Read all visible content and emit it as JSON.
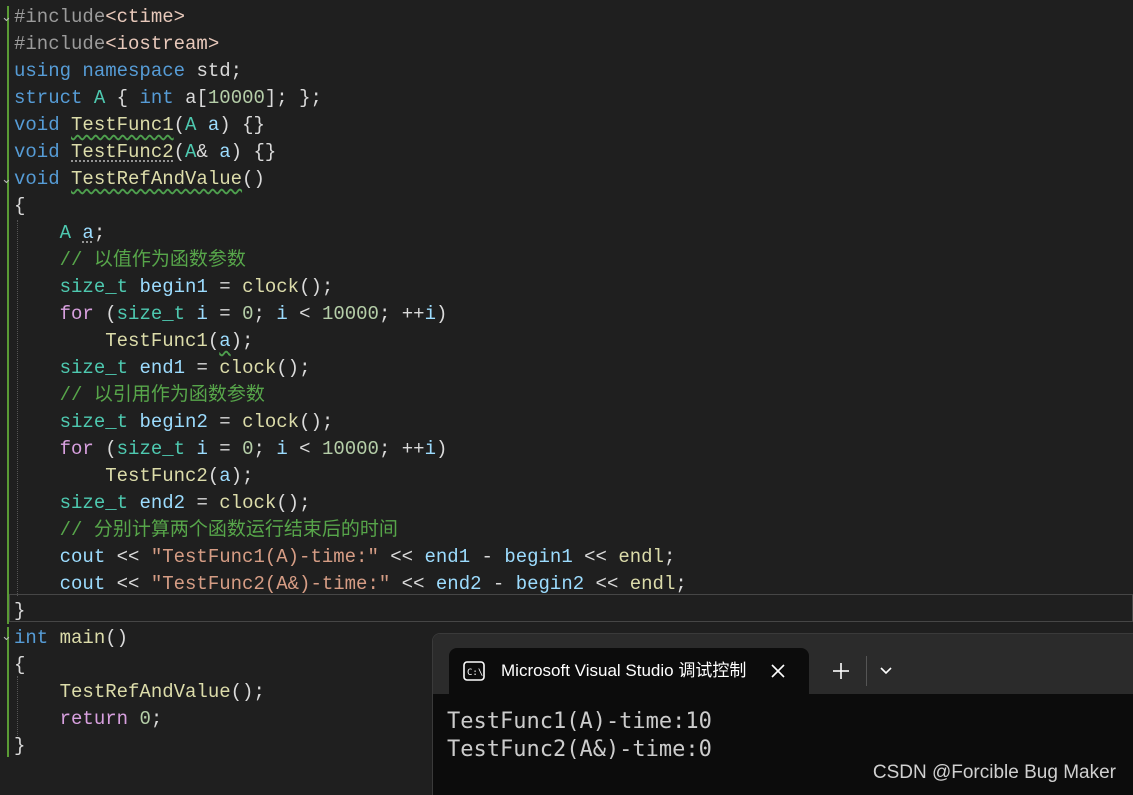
{
  "editor": {
    "lines": [
      [
        [
          "t-pp",
          "#include"
        ],
        [
          "t-inc",
          "<ctime>"
        ]
      ],
      [
        [
          "t-pp",
          "#include"
        ],
        [
          "t-inc",
          "<iostream>"
        ]
      ],
      [
        [
          "t-kw",
          "using"
        ],
        [
          "t-plain",
          " "
        ],
        [
          "t-kw",
          "namespace"
        ],
        [
          "t-plain",
          " std;"
        ]
      ],
      [
        [
          "t-kw",
          "struct"
        ],
        [
          "t-plain",
          " "
        ],
        [
          "t-type",
          "A"
        ],
        [
          "t-plain",
          " { "
        ],
        [
          "t-kw",
          "int"
        ],
        [
          "t-plain",
          " a["
        ],
        [
          "t-num",
          "10000"
        ],
        [
          "t-plain",
          "]; };"
        ]
      ],
      [
        [
          "t-kw",
          "void"
        ],
        [
          "t-plain",
          " "
        ],
        [
          "t-fn squiggle",
          "TestFunc1"
        ],
        [
          "t-plain",
          "("
        ],
        [
          "t-type",
          "A"
        ],
        [
          "t-plain",
          " "
        ],
        [
          "t-var",
          "a"
        ],
        [
          "t-plain",
          ") {}"
        ]
      ],
      [
        [
          "t-kw",
          "void"
        ],
        [
          "t-plain",
          " "
        ],
        [
          "t-fn dotted",
          "TestFunc2"
        ],
        [
          "t-plain",
          "("
        ],
        [
          "t-type",
          "A"
        ],
        [
          "t-plain",
          "& "
        ],
        [
          "t-var",
          "a"
        ],
        [
          "t-plain",
          ") {}"
        ]
      ],
      [
        [
          "t-kw",
          "void"
        ],
        [
          "t-plain",
          " "
        ],
        [
          "t-fn squiggle",
          "TestRefAndValue"
        ],
        [
          "t-plain",
          "()"
        ]
      ],
      [
        [
          "t-plain",
          "{"
        ]
      ],
      [
        [
          "t-plain",
          "    "
        ],
        [
          "t-type",
          "A"
        ],
        [
          "t-plain",
          " "
        ],
        [
          "t-var dotted",
          "a"
        ],
        [
          "t-plain",
          ";"
        ]
      ],
      [
        [
          "t-plain",
          "    "
        ],
        [
          "t-cmt",
          "// 以值作为函数参数"
        ]
      ],
      [
        [
          "t-plain",
          "    "
        ],
        [
          "t-type",
          "size_t"
        ],
        [
          "t-plain",
          " "
        ],
        [
          "t-var",
          "begin1"
        ],
        [
          "t-plain",
          " = "
        ],
        [
          "t-fn",
          "clock"
        ],
        [
          "t-plain",
          "();"
        ]
      ],
      [
        [
          "t-plain",
          "    "
        ],
        [
          "t-ctl",
          "for"
        ],
        [
          "t-plain",
          " ("
        ],
        [
          "t-type",
          "size_t"
        ],
        [
          "t-plain",
          " "
        ],
        [
          "t-var",
          "i"
        ],
        [
          "t-plain",
          " = "
        ],
        [
          "t-num",
          "0"
        ],
        [
          "t-plain",
          "; "
        ],
        [
          "t-var",
          "i"
        ],
        [
          "t-plain",
          " < "
        ],
        [
          "t-num",
          "10000"
        ],
        [
          "t-plain",
          "; ++"
        ],
        [
          "t-var",
          "i"
        ],
        [
          "t-plain",
          ")"
        ]
      ],
      [
        [
          "t-plain",
          "        "
        ],
        [
          "t-fn",
          "TestFunc1"
        ],
        [
          "t-plain",
          "("
        ],
        [
          "t-var squiggle",
          "a"
        ],
        [
          "t-plain",
          ");"
        ]
      ],
      [
        [
          "t-plain",
          "    "
        ],
        [
          "t-type",
          "size_t"
        ],
        [
          "t-plain",
          " "
        ],
        [
          "t-var",
          "end1"
        ],
        [
          "t-plain",
          " = "
        ],
        [
          "t-fn",
          "clock"
        ],
        [
          "t-plain",
          "();"
        ]
      ],
      [
        [
          "t-plain",
          "    "
        ],
        [
          "t-cmt",
          "// 以引用作为函数参数"
        ]
      ],
      [
        [
          "t-plain",
          "    "
        ],
        [
          "t-type",
          "size_t"
        ],
        [
          "t-plain",
          " "
        ],
        [
          "t-var",
          "begin2"
        ],
        [
          "t-plain",
          " = "
        ],
        [
          "t-fn",
          "clock"
        ],
        [
          "t-plain",
          "();"
        ]
      ],
      [
        [
          "t-plain",
          "    "
        ],
        [
          "t-ctl",
          "for"
        ],
        [
          "t-plain",
          " ("
        ],
        [
          "t-type",
          "size_t"
        ],
        [
          "t-plain",
          " "
        ],
        [
          "t-var",
          "i"
        ],
        [
          "t-plain",
          " = "
        ],
        [
          "t-num",
          "0"
        ],
        [
          "t-plain",
          "; "
        ],
        [
          "t-var",
          "i"
        ],
        [
          "t-plain",
          " < "
        ],
        [
          "t-num",
          "10000"
        ],
        [
          "t-plain",
          "; ++"
        ],
        [
          "t-var",
          "i"
        ],
        [
          "t-plain",
          ")"
        ]
      ],
      [
        [
          "t-plain",
          "        "
        ],
        [
          "t-fn",
          "TestFunc2"
        ],
        [
          "t-plain",
          "("
        ],
        [
          "t-var",
          "a"
        ],
        [
          "t-plain",
          ");"
        ]
      ],
      [
        [
          "t-plain",
          "    "
        ],
        [
          "t-type",
          "size_t"
        ],
        [
          "t-plain",
          " "
        ],
        [
          "t-var",
          "end2"
        ],
        [
          "t-plain",
          " = "
        ],
        [
          "t-fn",
          "clock"
        ],
        [
          "t-plain",
          "();"
        ]
      ],
      [
        [
          "t-plain",
          "    "
        ],
        [
          "t-cmt",
          "// 分别计算两个函数运行结束后的时间"
        ]
      ],
      [
        [
          "t-plain",
          "    "
        ],
        [
          "t-var",
          "cout"
        ],
        [
          "t-plain",
          " << "
        ],
        [
          "t-str",
          "\"TestFunc1(A)-time:\""
        ],
        [
          "t-plain",
          " << "
        ],
        [
          "t-var",
          "end1"
        ],
        [
          "t-plain",
          " - "
        ],
        [
          "t-var",
          "begin1"
        ],
        [
          "t-plain",
          " << "
        ],
        [
          "t-fn",
          "endl"
        ],
        [
          "t-plain",
          ";"
        ]
      ],
      [
        [
          "t-plain",
          "    "
        ],
        [
          "t-var",
          "cout"
        ],
        [
          "t-plain",
          " << "
        ],
        [
          "t-str",
          "\"TestFunc2(A&)-time:\""
        ],
        [
          "t-plain",
          " << "
        ],
        [
          "t-var",
          "end2"
        ],
        [
          "t-plain",
          " - "
        ],
        [
          "t-var",
          "begin2"
        ],
        [
          "t-plain",
          " << "
        ],
        [
          "t-fn",
          "endl"
        ],
        [
          "t-plain",
          ";"
        ]
      ],
      [
        [
          "t-plain",
          "}"
        ]
      ],
      [
        [
          "t-kw",
          "int"
        ],
        [
          "t-plain",
          " "
        ],
        [
          "t-fn",
          "main"
        ],
        [
          "t-plain",
          "()"
        ]
      ],
      [
        [
          "t-plain",
          "{"
        ]
      ],
      [
        [
          "t-plain",
          "    "
        ],
        [
          "t-fn",
          "TestRefAndValue"
        ],
        [
          "t-plain",
          "();"
        ]
      ],
      [
        [
          "t-plain",
          "    "
        ],
        [
          "t-ctl",
          "return"
        ],
        [
          "t-plain",
          " "
        ],
        [
          "t-num",
          "0"
        ],
        [
          "t-plain",
          ";"
        ]
      ],
      [
        [
          "t-plain",
          "}"
        ]
      ]
    ],
    "fold_marker": "⌄"
  },
  "terminal": {
    "tab_title": "Microsoft Visual Studio 调试控制台",
    "output": [
      "TestFunc1(A)-time:10",
      "TestFunc2(A&)-time:0"
    ]
  },
  "watermark": "CSDN @Forcible Bug Maker",
  "colors": {
    "editor_bg": "#1f1f1f",
    "terminal_bg": "#0c0c0c",
    "titlebar_bg": "#2b2b2b",
    "comment": "#57a64a",
    "keyword": "#569cd6",
    "type": "#4ec9b0",
    "function": "#dcdcaa",
    "string": "#d69d85"
  },
  "icons": [
    "fold-chevron-icon",
    "console-app-icon",
    "close-icon",
    "plus-icon",
    "chevron-down-icon"
  ]
}
